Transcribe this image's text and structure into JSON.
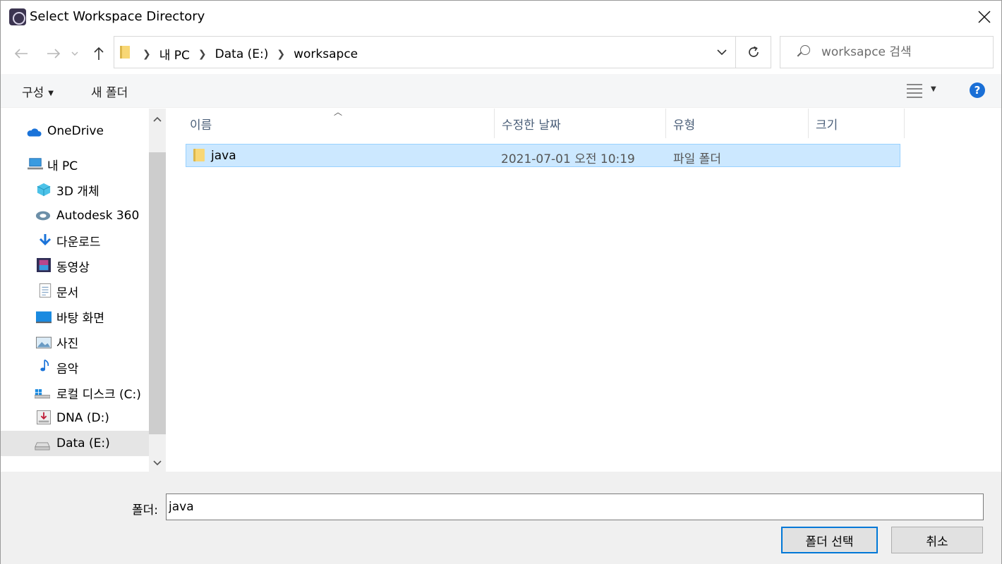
{
  "window": {
    "title": "Select Workspace Directory"
  },
  "address": {
    "crumbs": [
      "내 PC",
      "Data (E:)",
      "worksapce"
    ]
  },
  "search": {
    "placeholder": "worksapce 검색"
  },
  "toolbar": {
    "organize": "구성",
    "new_folder": "새 폴더",
    "help": "?"
  },
  "nav": {
    "items": [
      {
        "label": "OneDrive",
        "icon": "onedrive-icon"
      },
      {
        "label": "내 PC",
        "icon": "pc-icon"
      },
      {
        "label": "3D 개체",
        "icon": "3d-objects-icon"
      },
      {
        "label": "Autodesk 360",
        "icon": "autodesk-icon"
      },
      {
        "label": "다운로드",
        "icon": "download-icon"
      },
      {
        "label": "동영상",
        "icon": "video-icon"
      },
      {
        "label": "문서",
        "icon": "document-icon"
      },
      {
        "label": "바탕 화면",
        "icon": "desktop-icon"
      },
      {
        "label": "사진",
        "icon": "pictures-icon"
      },
      {
        "label": "음악",
        "icon": "music-icon"
      },
      {
        "label": "로컬 디스크 (C:)",
        "icon": "drive-c-icon"
      },
      {
        "label": "DNA (D:)",
        "icon": "drive-d-icon"
      },
      {
        "label": "Data (E:)",
        "icon": "drive-e-icon"
      }
    ]
  },
  "columns": {
    "name": "이름",
    "modified": "수정한 날짜",
    "type": "유형",
    "size": "크기"
  },
  "files": [
    {
      "name": "java",
      "modified": "2021-07-01 오전 10:19",
      "type": "파일 폴더",
      "size": ""
    }
  ],
  "bottom": {
    "folder_label": "폴더:",
    "folder_value": "java",
    "select_button": "폴더 선택",
    "cancel_button": "취소"
  },
  "colors": {
    "selection": "#cce8ff",
    "accent": "#0078d7",
    "help": "#1a6fd6"
  }
}
